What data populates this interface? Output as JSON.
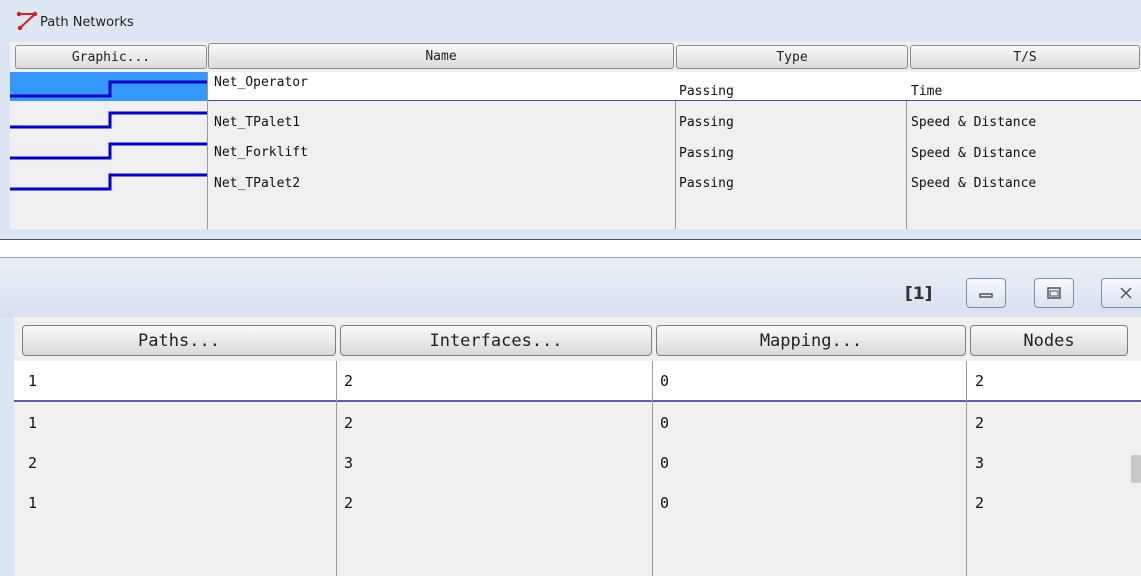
{
  "top_window": {
    "title": "Path Networks",
    "icon": "path-network-icon",
    "columns": [
      "Graphic...",
      "Name",
      "Type",
      "T/S"
    ],
    "rows": [
      {
        "name": "Net_Operator",
        "type": "Passing",
        "ts": "Time",
        "selected": true
      },
      {
        "name": "Net_TPalet1",
        "type": "Passing",
        "ts": "Speed & Distance",
        "selected": false
      },
      {
        "name": "Net_Forklift",
        "type": "Passing",
        "ts": "Speed & Distance",
        "selected": false
      },
      {
        "name": "Net_TPalet2",
        "type": "Passing",
        "ts": "Speed & Distance",
        "selected": false
      }
    ]
  },
  "bottom_window": {
    "window_index": "[1]",
    "controls": [
      "minimize-icon",
      "maximize-icon",
      "close-icon"
    ],
    "columns": [
      "Paths...",
      "Interfaces...",
      "Mapping...",
      "Nodes"
    ],
    "rows": [
      {
        "paths": "1",
        "interfaces": "2",
        "mapping": "0",
        "nodes": "2",
        "selected": true
      },
      {
        "paths": "1",
        "interfaces": "2",
        "mapping": "0",
        "nodes": "2",
        "selected": false
      },
      {
        "paths": "2",
        "interfaces": "3",
        "mapping": "0",
        "nodes": "3",
        "selected": false
      },
      {
        "paths": "1",
        "interfaces": "2",
        "mapping": "0",
        "nodes": "2",
        "selected": false
      }
    ]
  },
  "colors": {
    "accent_blue": "#0000cc",
    "selection_blue": "#3399ff",
    "panel_bg": "#dbe6f2"
  }
}
